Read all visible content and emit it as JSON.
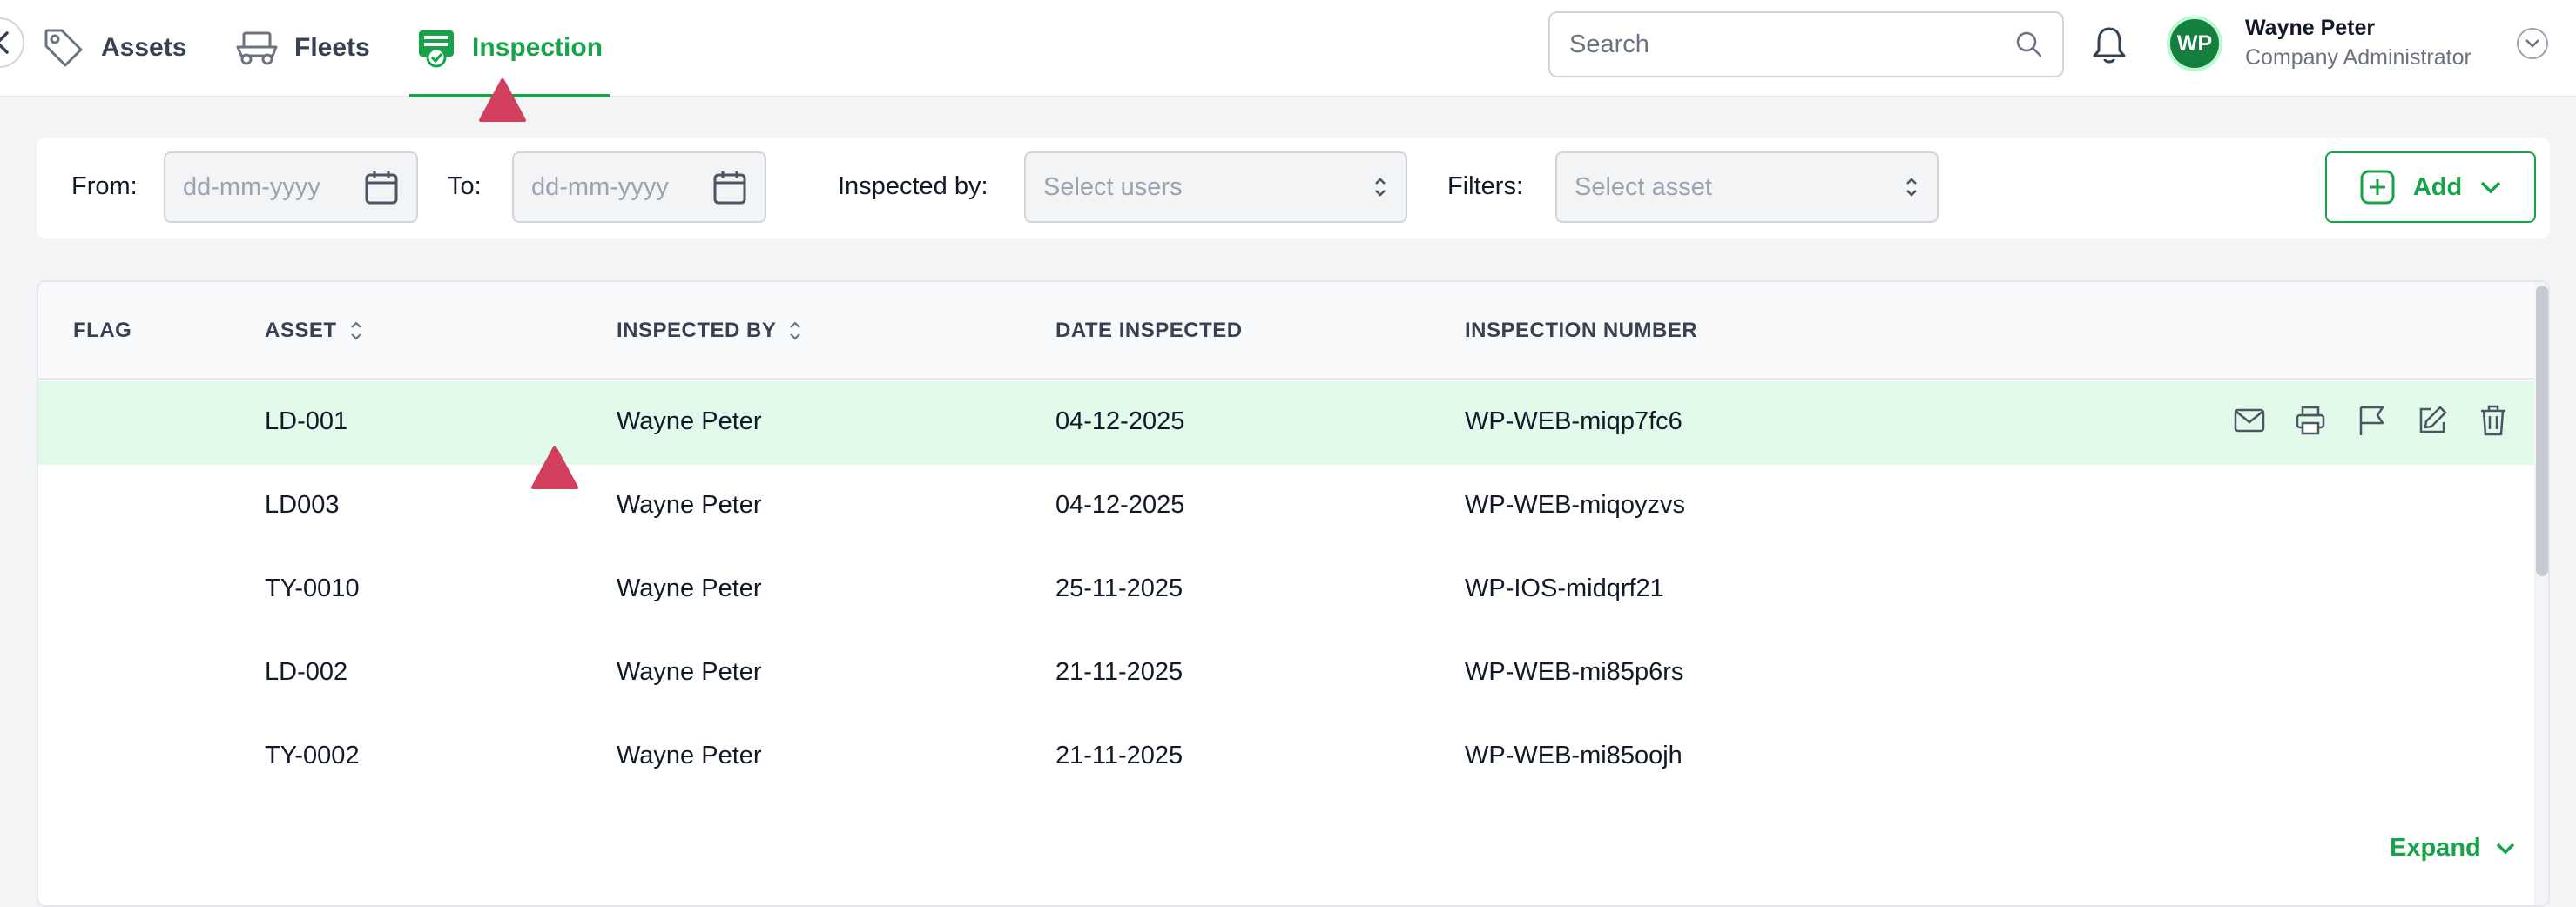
{
  "nav": {
    "tabs": [
      {
        "label": "Assets",
        "icon": "tag-icon"
      },
      {
        "label": "Fleets",
        "icon": "truck-icon"
      },
      {
        "label": "Inspection",
        "icon": "inspection-icon",
        "active": true
      }
    ]
  },
  "search": {
    "placeholder": "Search"
  },
  "user": {
    "initials": "WP",
    "name": "Wayne Peter",
    "role": "Company Administrator"
  },
  "filters": {
    "from_label": "From:",
    "from_placeholder": "dd-mm-yyyy",
    "to_label": "To:",
    "to_placeholder": "dd-mm-yyyy",
    "inspected_by_label": "Inspected by:",
    "inspected_by_placeholder": "Select users",
    "filters_label": "Filters:",
    "filters_placeholder": "Select asset",
    "add_label": "Add"
  },
  "table": {
    "columns": [
      "FLAG",
      "ASSET",
      "INSPECTED BY",
      "DATE INSPECTED",
      "INSPECTION NUMBER"
    ],
    "rows": [
      {
        "flag": "",
        "asset": "LD-001",
        "inspected_by": "Wayne Peter",
        "date": "04-12-2025",
        "number": "WP-WEB-miqp7fc6"
      },
      {
        "flag": "",
        "asset": "LD003",
        "inspected_by": "Wayne Peter",
        "date": "04-12-2025",
        "number": "WP-WEB-miqoyzvs"
      },
      {
        "flag": "",
        "asset": "TY-0010",
        "inspected_by": "Wayne Peter",
        "date": "25-11-2025",
        "number": "WP-IOS-midqrf21"
      },
      {
        "flag": "",
        "asset": "LD-002",
        "inspected_by": "Wayne Peter",
        "date": "21-11-2025",
        "number": "WP-WEB-mi85p6rs"
      },
      {
        "flag": "",
        "asset": "TY-0002",
        "inspected_by": "Wayne Peter",
        "date": "21-11-2025",
        "number": "WP-WEB-mi85oojh"
      }
    ],
    "row_actions": [
      "mail-icon",
      "printer-icon",
      "flag-icon",
      "edit-icon",
      "trash-icon"
    ],
    "expand_label": "Expand"
  },
  "colors": {
    "accent": "#16a34a",
    "highlight_row": "#e1faea",
    "marker": "#d23f5c"
  }
}
